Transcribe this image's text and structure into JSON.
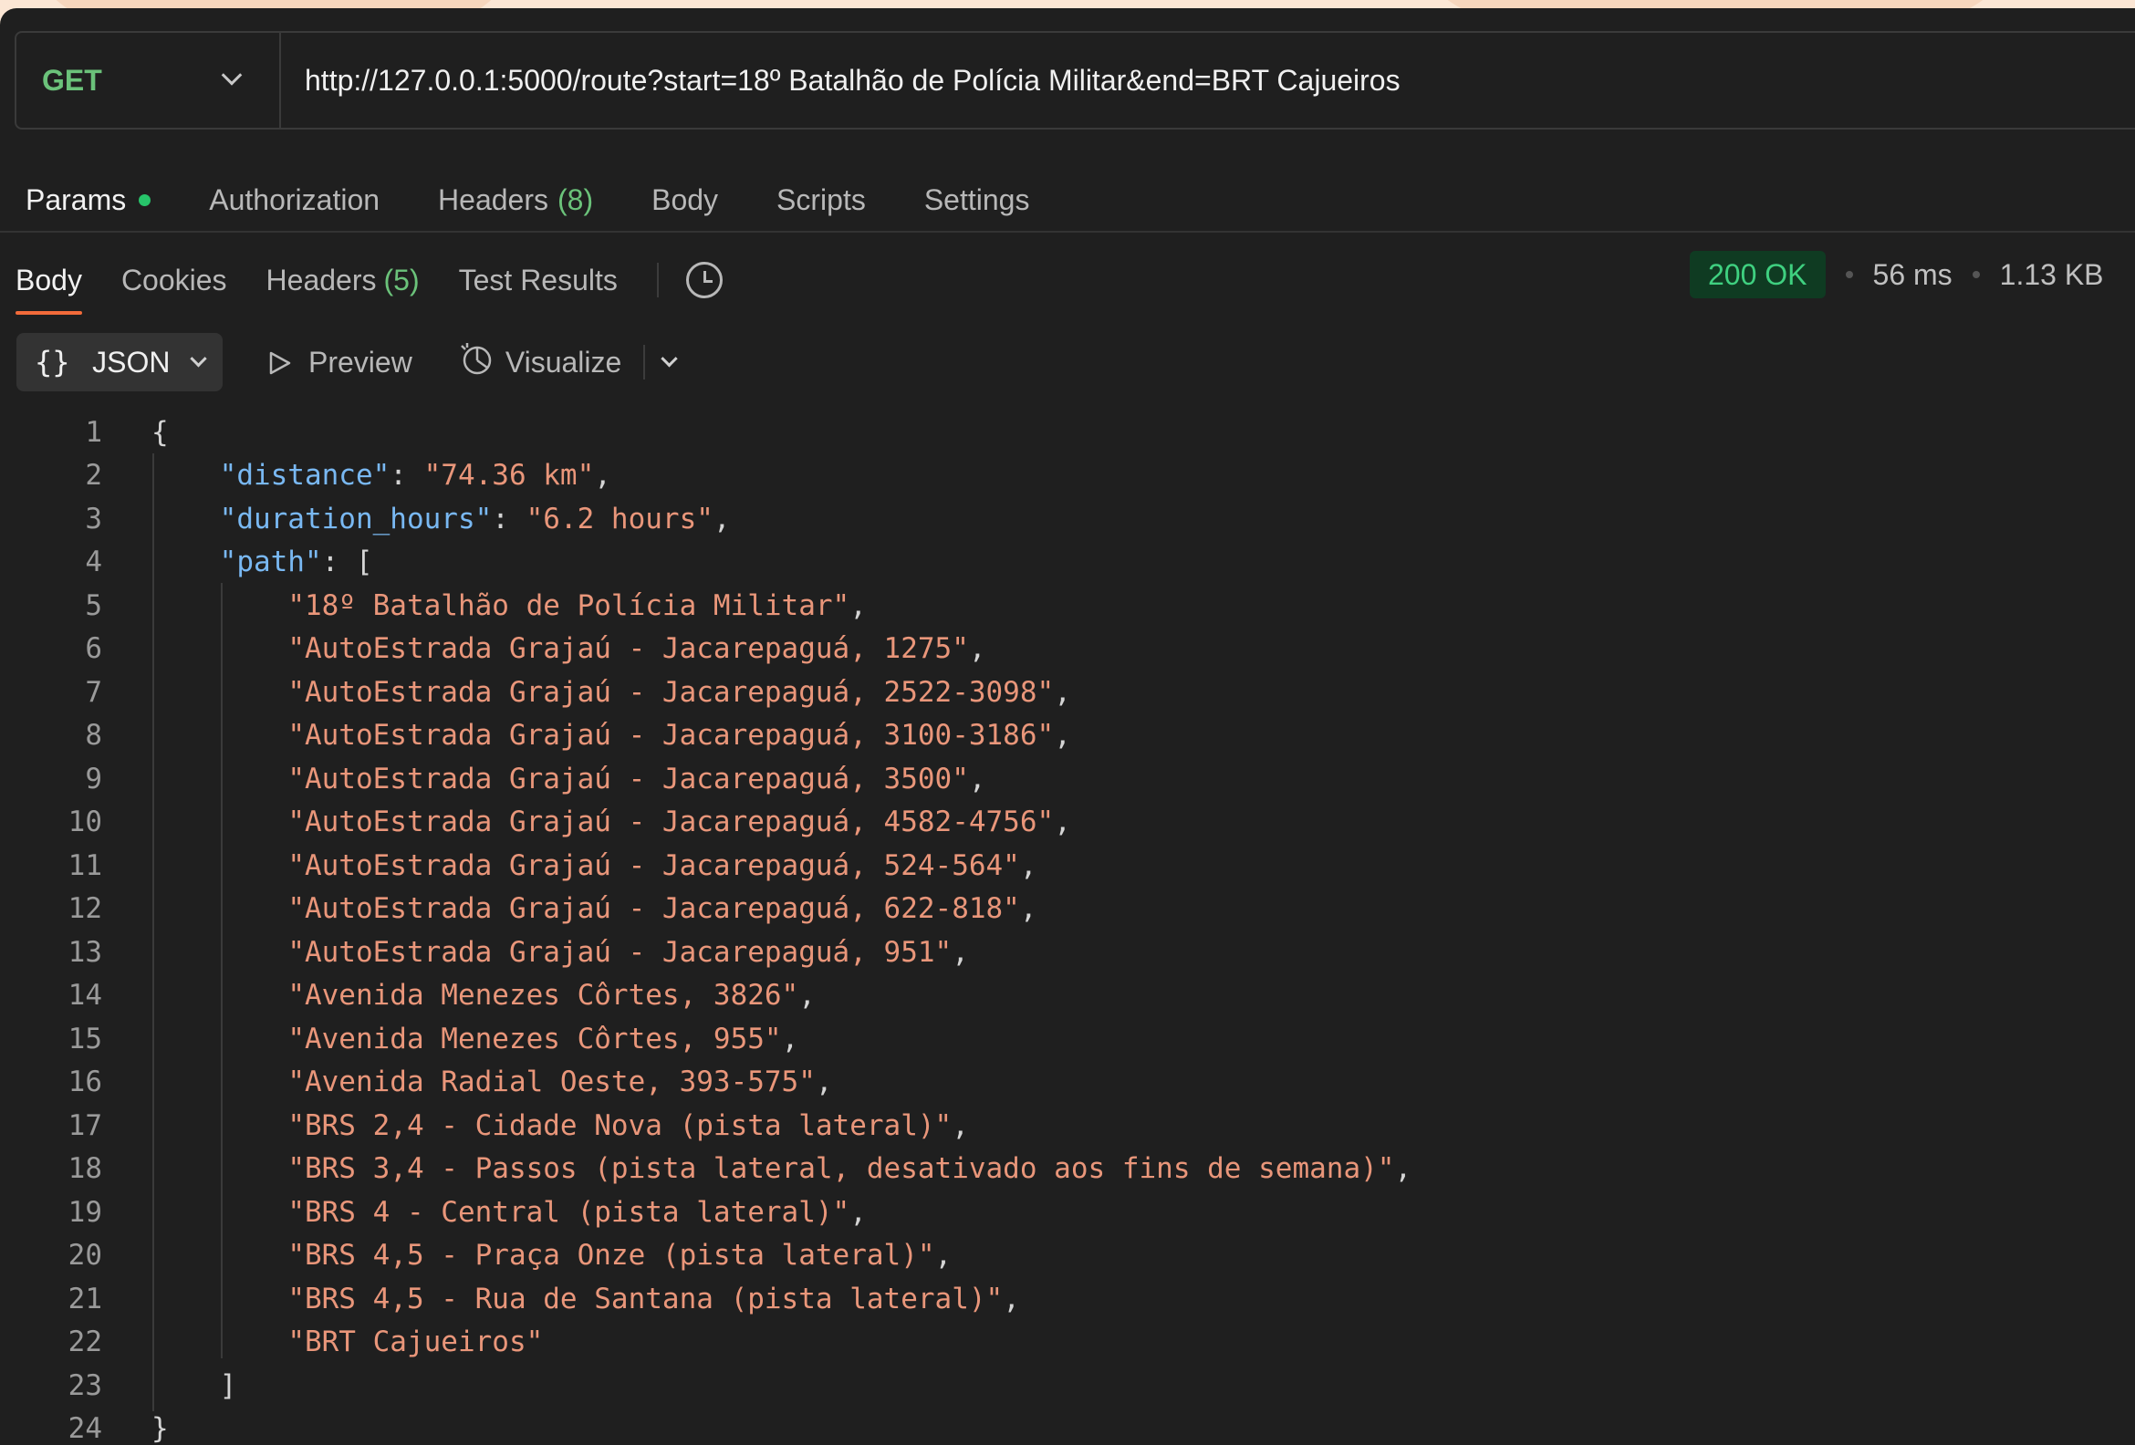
{
  "request": {
    "method": "GET",
    "url": "http://127.0.0.1:5000/route?start=18º Batalhão de Polícia Militar&end=BRT Cajueiros"
  },
  "request_tabs": {
    "params": "Params",
    "authorization": "Authorization",
    "headers": "Headers",
    "headers_count": "(8)",
    "body": "Body",
    "scripts": "Scripts",
    "settings": "Settings"
  },
  "response_tabs": {
    "body": "Body",
    "cookies": "Cookies",
    "headers": "Headers",
    "headers_count": "(5)",
    "test_results": "Test Results"
  },
  "status": {
    "code": "200 OK",
    "time": "56 ms",
    "size": "1.13 KB"
  },
  "toolbar": {
    "format_braces": "{}",
    "format": "JSON",
    "preview": "Preview",
    "visualize": "Visualize"
  },
  "code_lines": [
    {
      "n": "1",
      "text": "{"
    },
    {
      "n": "2",
      "key": "\"distance\"",
      "sep": ": ",
      "val": "\"74.36 km\"",
      "end": ","
    },
    {
      "n": "3",
      "key": "\"duration_hours\"",
      "sep": ": ",
      "val": "\"6.2 hours\"",
      "end": ","
    },
    {
      "n": "4",
      "key": "\"path\"",
      "sep": ": [",
      "val": "",
      "end": ""
    },
    {
      "n": "5",
      "val": "\"18º Batalhão de Polícia Militar\"",
      "end": ","
    },
    {
      "n": "6",
      "val": "\"AutoEstrada Grajaú - Jacarepaguá, 1275\"",
      "end": ","
    },
    {
      "n": "7",
      "val": "\"AutoEstrada Grajaú - Jacarepaguá, 2522-3098\"",
      "end": ","
    },
    {
      "n": "8",
      "val": "\"AutoEstrada Grajaú - Jacarepaguá, 3100-3186\"",
      "end": ","
    },
    {
      "n": "9",
      "val": "\"AutoEstrada Grajaú - Jacarepaguá, 3500\"",
      "end": ","
    },
    {
      "n": "10",
      "val": "\"AutoEstrada Grajaú - Jacarepaguá, 4582-4756\"",
      "end": ","
    },
    {
      "n": "11",
      "val": "\"AutoEstrada Grajaú - Jacarepaguá, 524-564\"",
      "end": ","
    },
    {
      "n": "12",
      "val": "\"AutoEstrada Grajaú - Jacarepaguá, 622-818\"",
      "end": ","
    },
    {
      "n": "13",
      "val": "\"AutoEstrada Grajaú - Jacarepaguá, 951\"",
      "end": ","
    },
    {
      "n": "14",
      "val": "\"Avenida Menezes Côrtes, 3826\"",
      "end": ","
    },
    {
      "n": "15",
      "val": "\"Avenida Menezes Côrtes, 955\"",
      "end": ","
    },
    {
      "n": "16",
      "val": "\"Avenida Radial Oeste, 393-575\"",
      "end": ","
    },
    {
      "n": "17",
      "val": "\"BRS 2,4 - Cidade Nova (pista lateral)\"",
      "end": ","
    },
    {
      "n": "18",
      "val": "\"BRS 3,4 - Passos (pista lateral, desativado aos fins de semana)\"",
      "end": ","
    },
    {
      "n": "19",
      "val": "\"BRS 4 - Central (pista lateral)\"",
      "end": ","
    },
    {
      "n": "20",
      "val": "\"BRS 4,5 - Praça Onze (pista lateral)\"",
      "end": ","
    },
    {
      "n": "21",
      "val": "\"BRS 4,5 - Rua de Santana (pista lateral)\"",
      "end": ","
    },
    {
      "n": "22",
      "val": "\"BRT Cajueiros\"",
      "end": ""
    },
    {
      "n": "23",
      "text": "]"
    },
    {
      "n": "24",
      "text": "}"
    }
  ],
  "colors": {
    "accent": "#f26b3a",
    "success": "#3fd080",
    "json_key": "#79b8f2",
    "json_string": "#e9967a",
    "background": "#1f1f1f"
  }
}
